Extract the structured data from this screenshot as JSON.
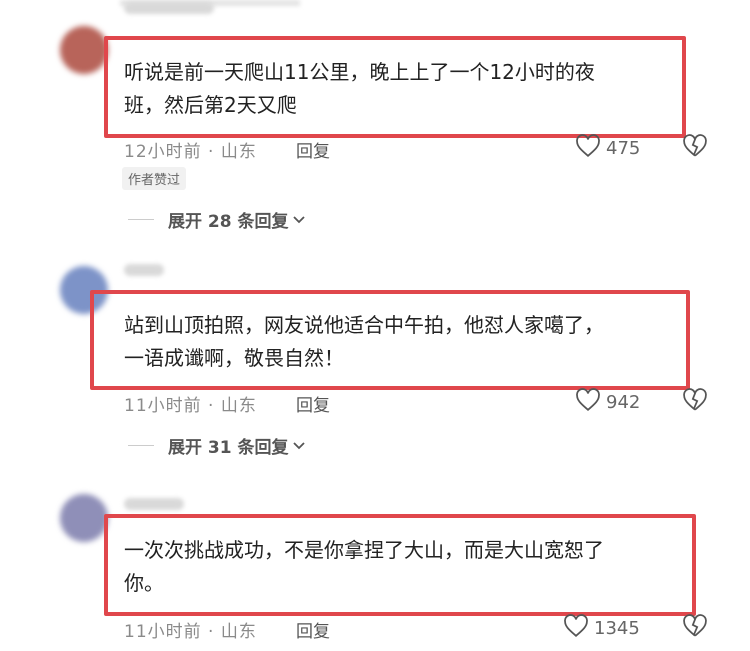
{
  "comments": [
    {
      "text": "听说是前一天爬山11公里，晚上上了一个12小时的夜\n班，然后第2天又爬",
      "time": "12小时前 · 山东",
      "reply": "回复",
      "likes": "475",
      "author_tag": "作者赞过",
      "expand": "展开 28 条回复",
      "avatar_color": "#b8645a"
    },
    {
      "text": "站到山顶拍照，网友说他适合中午拍，他怼人家噶了，\n一语成谶啊，敬畏自然！",
      "time": "11小时前 · 山东",
      "reply": "回复",
      "likes": "942",
      "expand": "展开 31 条回复",
      "avatar_color": "#7d93c8"
    },
    {
      "text": "一次次挑战成功，不是你拿捏了大山，而是大山宽恕了\n你。",
      "time": "11小时前 · 山东",
      "reply": "回复",
      "likes": "1345",
      "avatar_color": "#8f8fb8"
    }
  ],
  "colors": {
    "highlight_border": "#e0474c"
  }
}
